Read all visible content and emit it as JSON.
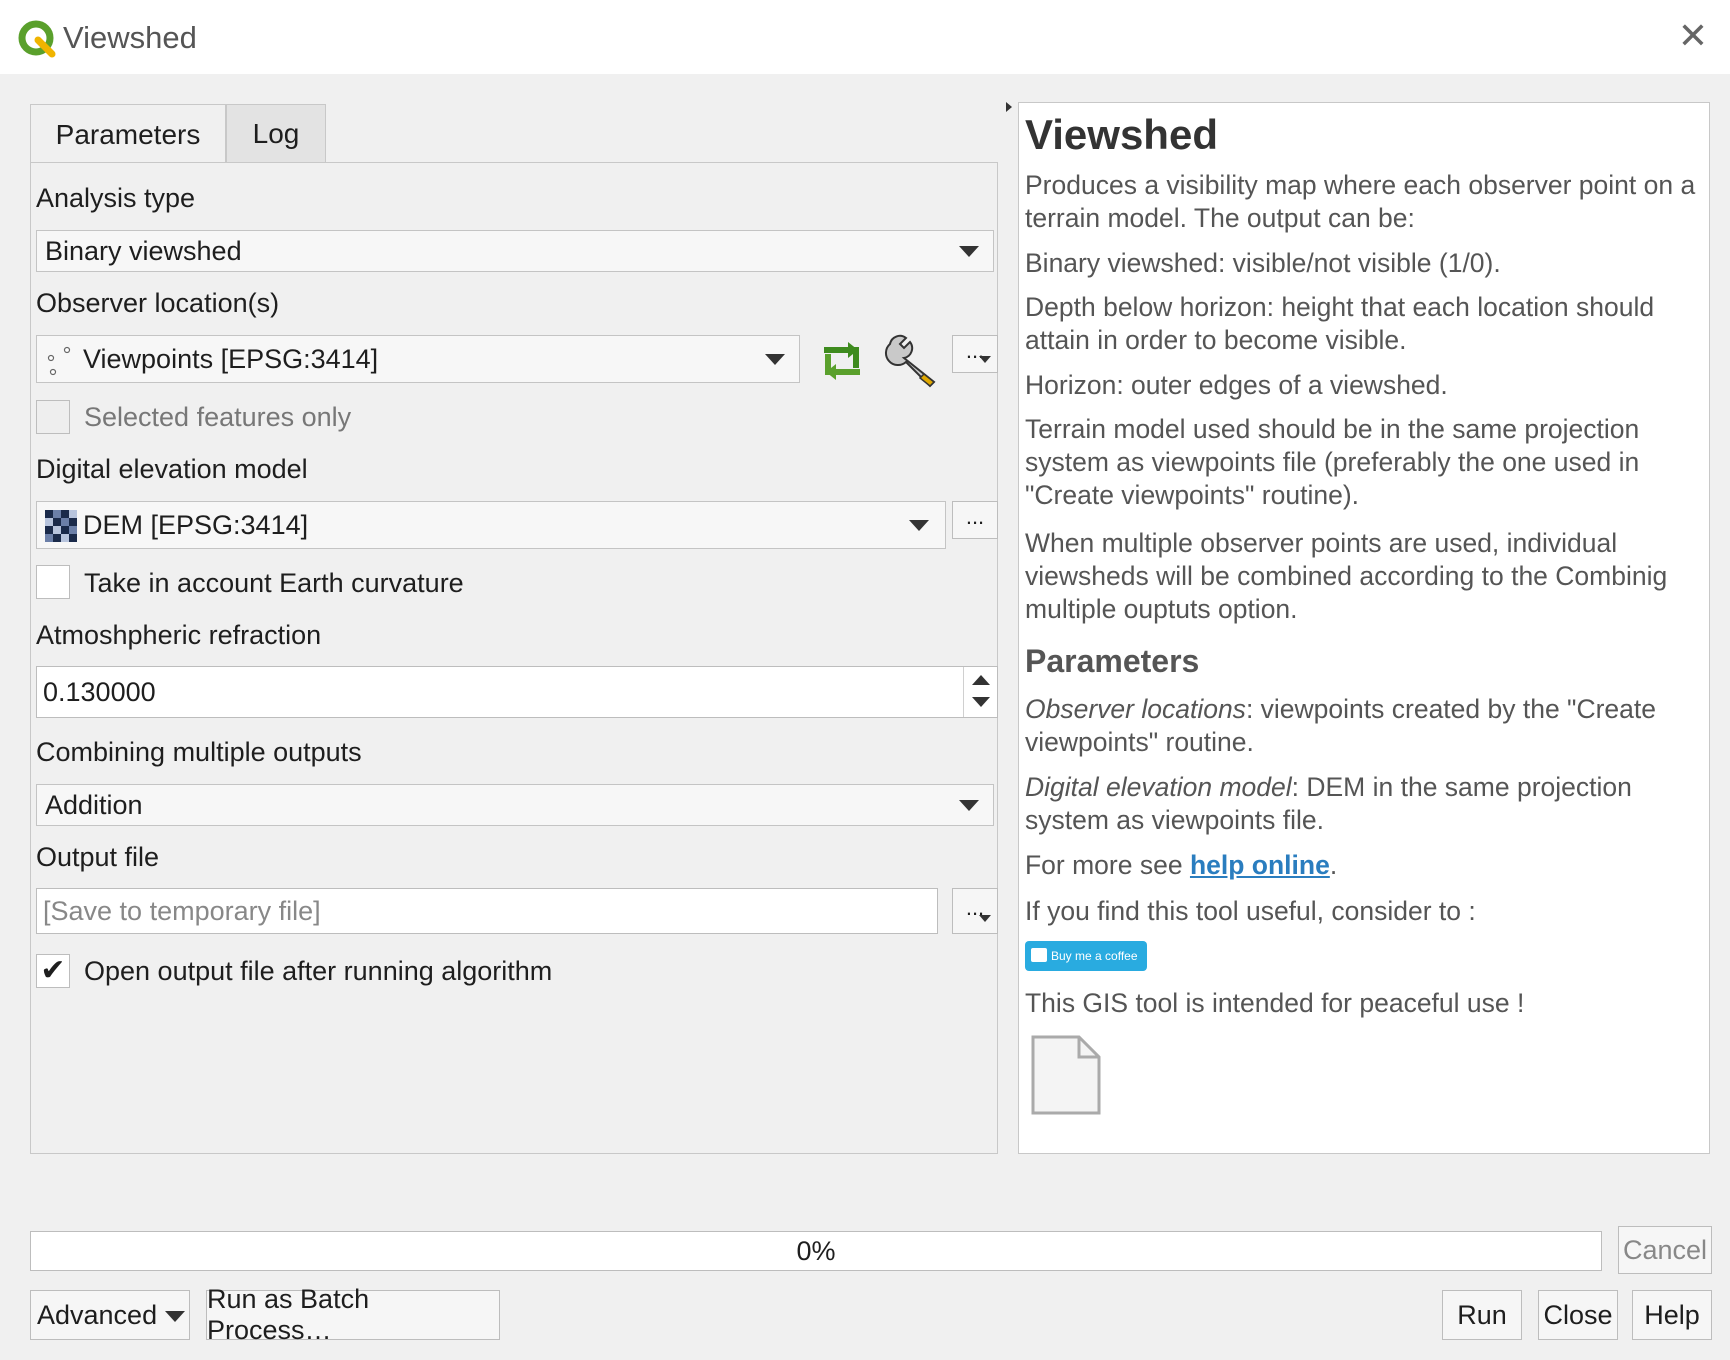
{
  "window": {
    "title": "Viewshed",
    "close_glyph": "✕"
  },
  "tabs": [
    {
      "label": "Parameters"
    },
    {
      "label": "Log"
    }
  ],
  "params": {
    "analysis_type": {
      "label": "Analysis type",
      "value": "Binary viewshed"
    },
    "observer": {
      "label": "Observer location(s)",
      "value": "Viewpoints [EPSG:3414]",
      "icons": [
        "refresh-icon",
        "wrench-icon"
      ],
      "more": "..."
    },
    "selected_only": {
      "label": "Selected features only",
      "checked": false
    },
    "dem": {
      "label": "Digital elevation model",
      "value": "DEM [EPSG:3414]",
      "more": "..."
    },
    "curvature": {
      "label": "Take in account Earth curvature",
      "checked": false
    },
    "refraction": {
      "label": "Atmoshpheric refraction",
      "value": "0.130000"
    },
    "combining": {
      "label": "Combining multiple outputs",
      "value": "Addition"
    },
    "output": {
      "label": "Output file",
      "placeholder": "[Save to temporary file]",
      "more": "..."
    },
    "open_output": {
      "label": "Open output file after running algorithm",
      "checked": true,
      "check_glyph": "✔"
    }
  },
  "help": {
    "title": "Viewshed",
    "p1": "Produces a visibility map where each observer point on a terrain model. The output can be:",
    "p2": "Binary viewshed: visible/not visible (1/0).",
    "p3": "Depth below horizon: height that each location should attain in order to become visible.",
    "p4": "Horizon: outer edges of a viewshed.",
    "p5": "Terrain model used should be in the same projection system as viewpoints file (preferably the one used in \"Create viewpoints\" routine).",
    "p6": "When multiple observer points are used, individual viewsheds will be combined according to the Combinig multiple ouptuts option.",
    "h2": "Parameters",
    "param1_name": "Observer locations",
    "param1_desc": ": viewpoints created by the \"Create viewpoints\" routine.",
    "param2_name": "Digital elevation model",
    "param2_desc": ": DEM in the same projection system as viewpoints file.",
    "more_prefix": "For more see ",
    "more_link": "help online",
    "more_suffix": ".",
    "consider": "If you find this tool useful, consider to :",
    "coffee_button": "Buy me a coffee",
    "peaceful": "This GIS tool is intended for peaceful use !"
  },
  "progress": {
    "value": 0.0,
    "label": "0%"
  },
  "buttons": {
    "cancel": "Cancel",
    "advanced": "Advanced",
    "batch": "Run as Batch Process…",
    "run": "Run",
    "close": "Close",
    "help": "Help"
  },
  "colors": {
    "accent_green": "#5aa02c",
    "link": "#2a7dbf",
    "coffee": "#29abe0"
  }
}
